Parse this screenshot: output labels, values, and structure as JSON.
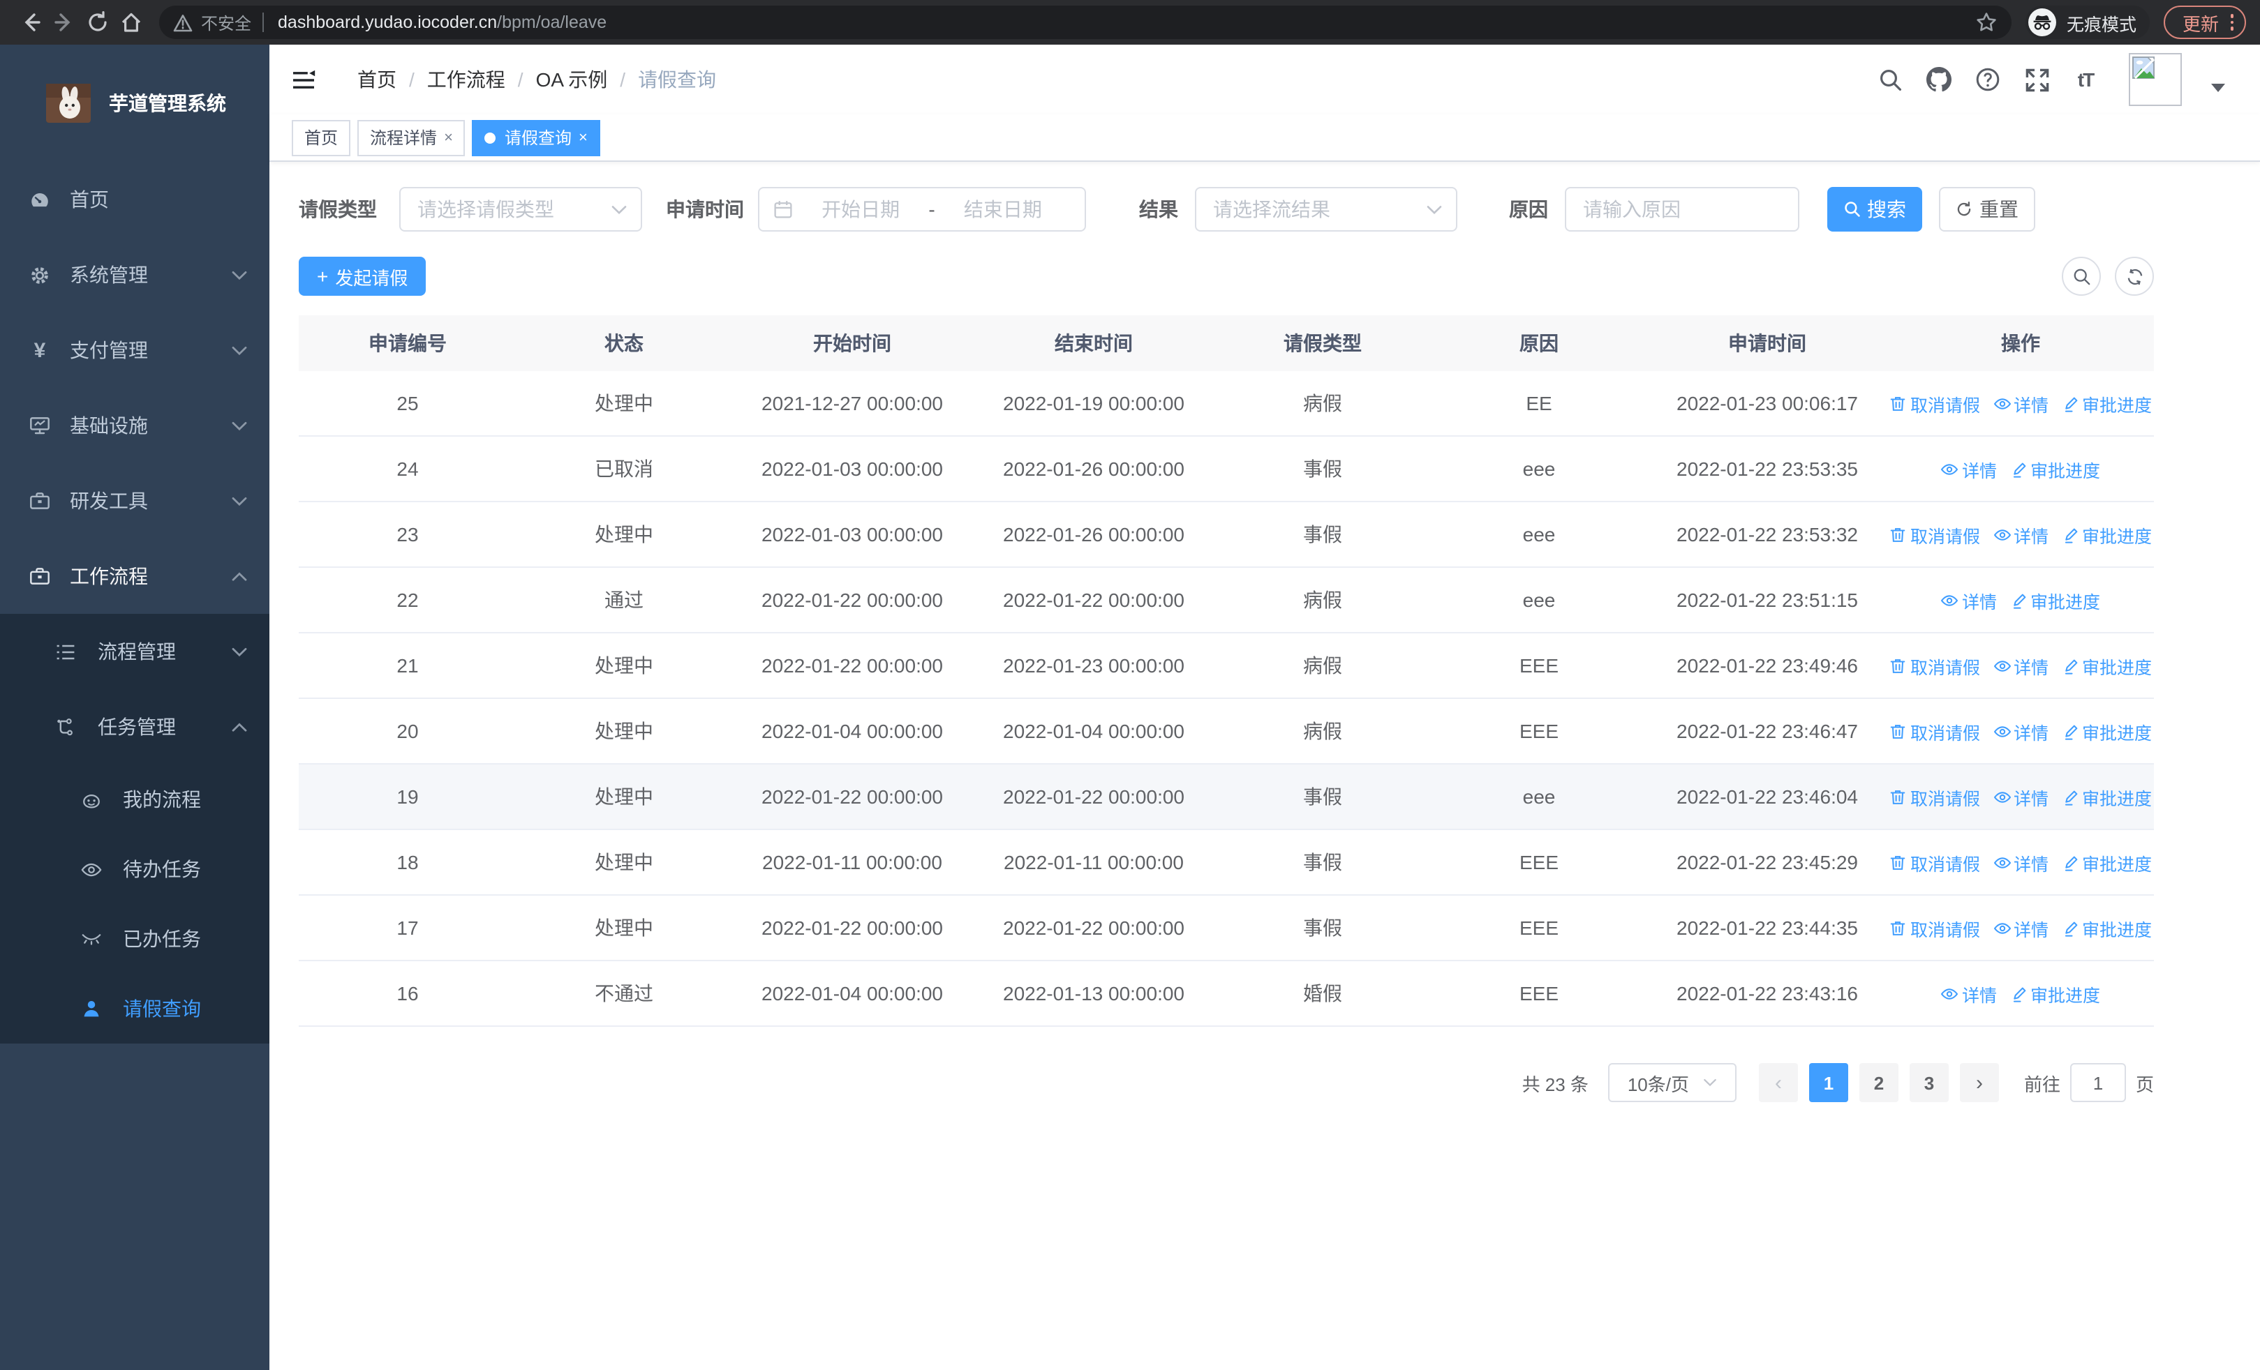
{
  "browser": {
    "security_label": "不安全",
    "url_host": "dashboard.yudao.iocoder.cn",
    "url_path": "/bpm/oa/leave",
    "incognito_label": "无痕模式",
    "update_label": "更新",
    "accent_color": "#ef9b90"
  },
  "sidebar": {
    "title": "芋道管理系统",
    "items": [
      {
        "icon": "dashboard-icon",
        "label": "首页"
      },
      {
        "icon": "gear-icon",
        "label": "系统管理"
      },
      {
        "icon": "yen-icon",
        "label": "支付管理"
      },
      {
        "icon": "monitor-icon",
        "label": "基础设施"
      },
      {
        "icon": "toolbox-icon",
        "label": "研发工具"
      },
      {
        "icon": "briefcase-icon",
        "label": "工作流程"
      }
    ],
    "workflow_children": [
      {
        "icon": "list-icon",
        "label": "流程管理"
      },
      {
        "icon": "tree-icon",
        "label": "任务管理"
      }
    ],
    "task_children": [
      {
        "icon": "face-icon",
        "label": "我的流程"
      },
      {
        "icon": "eye-icon",
        "label": "待办任务"
      },
      {
        "icon": "eye-closed-icon",
        "label": "已办任务"
      },
      {
        "icon": "user-icon",
        "label": "请假查询"
      }
    ]
  },
  "header": {
    "breadcrumb": [
      "首页",
      "工作流程",
      "OA 示例",
      "请假查询"
    ]
  },
  "tabs": [
    {
      "label": "首页"
    },
    {
      "label": "流程详情"
    },
    {
      "label": "请假查询"
    }
  ],
  "filters": {
    "leave_type_label": "请假类型",
    "leave_type_placeholder": "请选择请假类型",
    "apply_time_label": "申请时间",
    "date_start_placeholder": "开始日期",
    "date_separator": "-",
    "date_end_placeholder": "结束日期",
    "result_label": "结果",
    "result_placeholder": "请选择流结果",
    "reason_label": "原因",
    "reason_placeholder": "请输入原因",
    "search_label": "搜索",
    "reset_label": "重置"
  },
  "toolbar": {
    "create_label": "发起请假"
  },
  "table": {
    "headers": [
      "申请编号",
      "状态",
      "开始时间",
      "结束时间",
      "请假类型",
      "原因",
      "申请时间",
      "操作"
    ],
    "action_labels": {
      "cancel": "取消请假",
      "detail": "详情",
      "progress": "审批进度"
    },
    "rows": [
      {
        "id": "25",
        "status": "处理中",
        "start": "2021-12-27 00:00:00",
        "end": "2022-01-19 00:00:00",
        "type": "病假",
        "reason": "EE",
        "applied": "2022-01-23 00:06:17",
        "cancellable": true,
        "highlight": false
      },
      {
        "id": "24",
        "status": "已取消",
        "start": "2022-01-03 00:00:00",
        "end": "2022-01-26 00:00:00",
        "type": "事假",
        "reason": "eee",
        "applied": "2022-01-22 23:53:35",
        "cancellable": false,
        "highlight": false
      },
      {
        "id": "23",
        "status": "处理中",
        "start": "2022-01-03 00:00:00",
        "end": "2022-01-26 00:00:00",
        "type": "事假",
        "reason": "eee",
        "applied": "2022-01-22 23:53:32",
        "cancellable": true,
        "highlight": false
      },
      {
        "id": "22",
        "status": "通过",
        "start": "2022-01-22 00:00:00",
        "end": "2022-01-22 00:00:00",
        "type": "病假",
        "reason": "eee",
        "applied": "2022-01-22 23:51:15",
        "cancellable": false,
        "highlight": false
      },
      {
        "id": "21",
        "status": "处理中",
        "start": "2022-01-22 00:00:00",
        "end": "2022-01-23 00:00:00",
        "type": "病假",
        "reason": "EEE",
        "applied": "2022-01-22 23:49:46",
        "cancellable": true,
        "highlight": false
      },
      {
        "id": "20",
        "status": "处理中",
        "start": "2022-01-04 00:00:00",
        "end": "2022-01-04 00:00:00",
        "type": "病假",
        "reason": "EEE",
        "applied": "2022-01-22 23:46:47",
        "cancellable": true,
        "highlight": false
      },
      {
        "id": "19",
        "status": "处理中",
        "start": "2022-01-22 00:00:00",
        "end": "2022-01-22 00:00:00",
        "type": "事假",
        "reason": "eee",
        "applied": "2022-01-22 23:46:04",
        "cancellable": true,
        "highlight": true
      },
      {
        "id": "18",
        "status": "处理中",
        "start": "2022-01-11 00:00:00",
        "end": "2022-01-11 00:00:00",
        "type": "事假",
        "reason": "EEE",
        "applied": "2022-01-22 23:45:29",
        "cancellable": true,
        "highlight": false
      },
      {
        "id": "17",
        "status": "处理中",
        "start": "2022-01-22 00:00:00",
        "end": "2022-01-22 00:00:00",
        "type": "事假",
        "reason": "EEE",
        "applied": "2022-01-22 23:44:35",
        "cancellable": true,
        "highlight": false
      },
      {
        "id": "16",
        "status": "不通过",
        "start": "2022-01-04 00:00:00",
        "end": "2022-01-13 00:00:00",
        "type": "婚假",
        "reason": "EEE",
        "applied": "2022-01-22 23:43:16",
        "cancellable": false,
        "highlight": false
      }
    ]
  },
  "pagination": {
    "total": "共 23 条",
    "page_size": "10条/页",
    "pages": [
      "1",
      "2",
      "3"
    ],
    "active_page": "1",
    "goto_label": "前往",
    "goto_value": "1",
    "unit_label": "页"
  },
  "colors": {
    "accent": "#409eff",
    "sidebar_bg": "#304156",
    "submenu_bg": "#1f2d3d"
  }
}
